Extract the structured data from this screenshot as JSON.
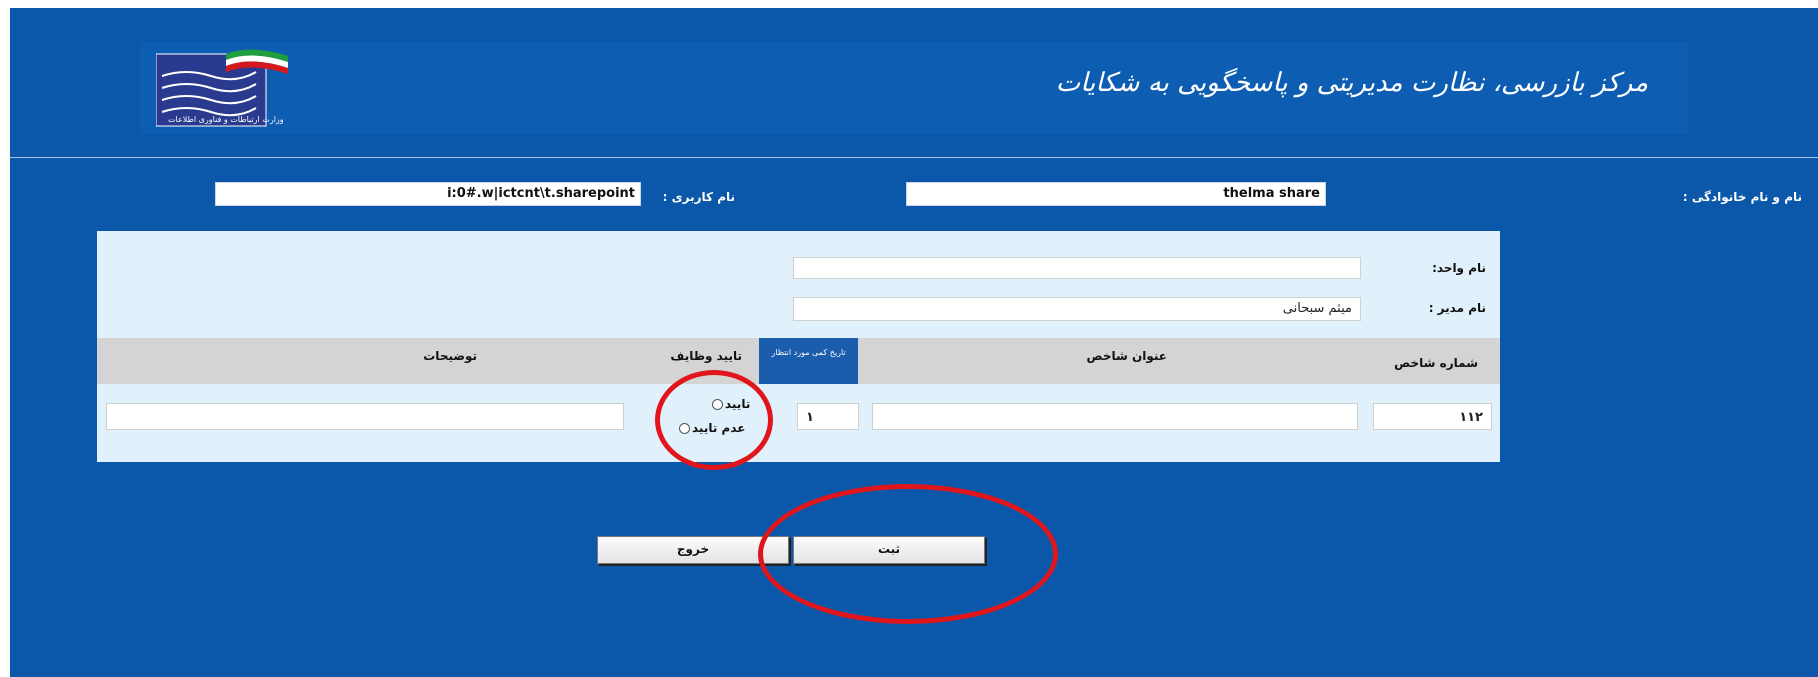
{
  "header": {
    "title": "مرکز بازرسی، نظارت مدیریتی و پاسخگویی به شکایات",
    "logo_text": "وزارت ارتباطات و فناوری اطلاعات"
  },
  "user": {
    "full_name_label": "نام  و نام خانوادگی :",
    "full_name_value": "thelma share",
    "username_label": "نام کاربری :",
    "username_value": "i:0#.w|ictcnt\\t.sharepoint"
  },
  "unit": {
    "unit_label": "نام واحد:",
    "unit_value": "",
    "manager_label": "نام مدیر :",
    "manager_value": "میثم سبحانی"
  },
  "grid": {
    "headers": {
      "index_number": "شماره شاخص",
      "index_title": "عنوان شاخص",
      "expected_value": "تاریخ کمی مورد انتظار",
      "duty_approval": "تایید وظایف",
      "notes": "توضیحات"
    },
    "row": {
      "index_number": "۱۱۲",
      "index_title": "",
      "expected_value": "۱",
      "approve_label": "تایید",
      "reject_label": "عدم تایید",
      "notes": ""
    }
  },
  "buttons": {
    "submit": "ثبت",
    "exit": "خروج"
  },
  "colors": {
    "page_bg": "#0b57a9",
    "panel_bg": "#e0f1fc",
    "grid_header_bg": "#d4d4d4",
    "highlight_ring": "#e0161c"
  }
}
